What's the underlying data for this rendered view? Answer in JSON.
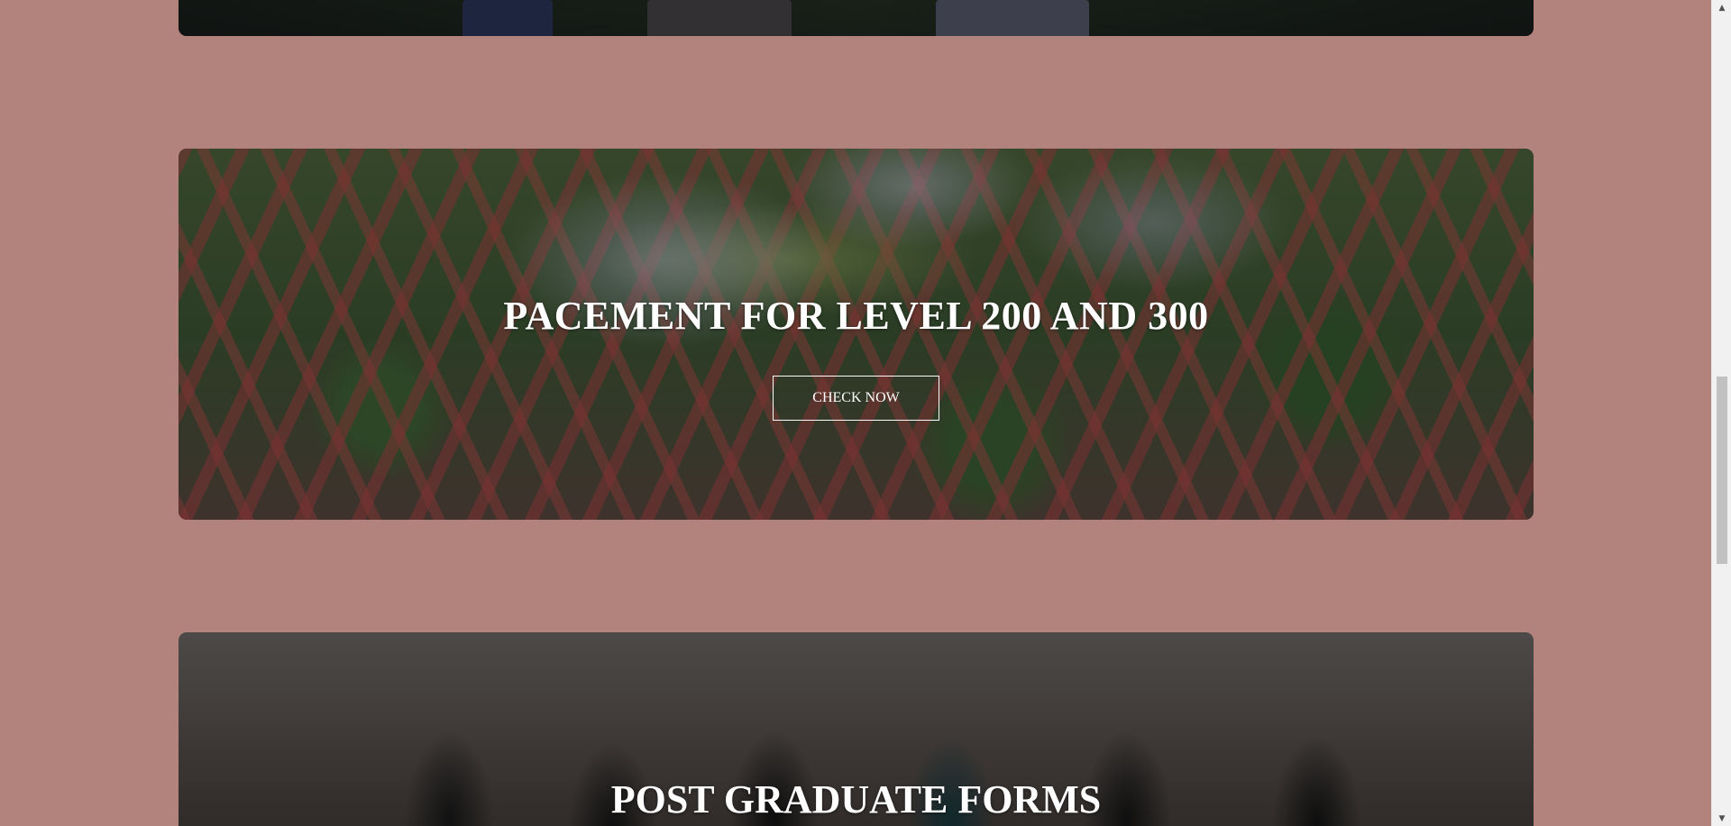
{
  "cards": [
    {
      "title": "",
      "button_label": ""
    },
    {
      "title": "PACEMENT FOR LEVEL 200 AND 300",
      "button_label": "CHECK NOW"
    },
    {
      "title": "POST GRADUATE FORMS",
      "button_label": ""
    }
  ],
  "colors": {
    "page_background": "#b2827d",
    "title_text": "#ffffff",
    "scrollbar_track": "#f1f1f1",
    "scrollbar_thumb": "#c1c1c1"
  },
  "scrollbar": {
    "up_icon": "triangle-up-icon",
    "down_icon": "triangle-down-icon",
    "scroll_position_fraction": 0.5
  }
}
